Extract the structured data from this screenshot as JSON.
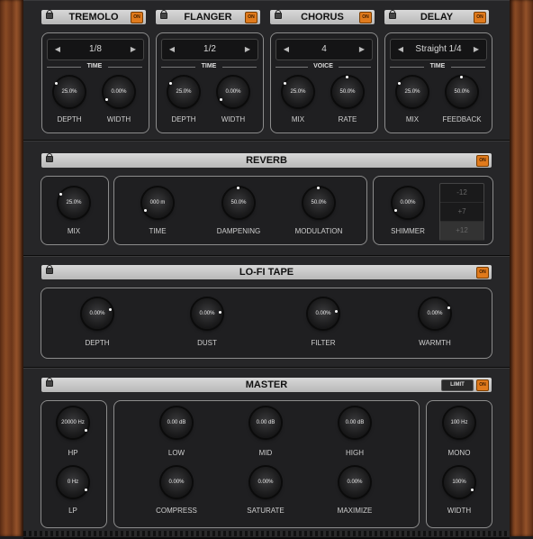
{
  "modules": {
    "tremolo": {
      "title": "TREMOLO",
      "on": "ON",
      "selector": "1/8",
      "section": "TIME",
      "knobs": [
        {
          "value": "25.0%",
          "label": "DEPTH"
        },
        {
          "value": "0.00%",
          "label": "WIDTH"
        }
      ]
    },
    "flanger": {
      "title": "FLANGER",
      "on": "ON",
      "selector": "1/2",
      "section": "TIME",
      "knobs": [
        {
          "value": "25.0%",
          "label": "DEPTH"
        },
        {
          "value": "0.00%",
          "label": "WIDTH"
        }
      ]
    },
    "chorus": {
      "title": "CHORUS",
      "on": "ON",
      "selector": "4",
      "section": "VOICE",
      "knobs": [
        {
          "value": "25.0%",
          "label": "MIX"
        },
        {
          "value": "50.0%",
          "label": "RATE"
        }
      ]
    },
    "delay": {
      "title": "DELAY",
      "on": "ON",
      "selector": "Straight 1/4",
      "section": "TIME",
      "knobs": [
        {
          "value": "25.0%",
          "label": "MIX"
        },
        {
          "value": "50.0%",
          "label": "FEEDBACK"
        }
      ]
    },
    "reverb": {
      "title": "REVERB",
      "on": "ON",
      "knobs": [
        {
          "value": "25.0%",
          "label": "MIX"
        },
        {
          "value": "000 m",
          "label": "TIME"
        },
        {
          "value": "50.0%",
          "label": "DAMPENING"
        },
        {
          "value": "50.0%",
          "label": "MODULATION"
        },
        {
          "value": "0.00%",
          "label": "SHIMMER"
        }
      ],
      "shimmer_options": [
        "-12",
        "+7",
        "+12"
      ]
    },
    "lofi": {
      "title": "LO-FI TAPE",
      "on": "ON",
      "knobs": [
        {
          "value": "0.00%",
          "label": "DEPTH"
        },
        {
          "value": "0.00%",
          "label": "DUST"
        },
        {
          "value": "0.00%",
          "label": "FILTER"
        },
        {
          "value": "0.00%",
          "label": "WARMTH"
        }
      ]
    },
    "master": {
      "title": "MASTER",
      "on": "ON",
      "limit": "LIMIT",
      "knobs": [
        {
          "value": "20000 Hz",
          "label": "HP"
        },
        {
          "value": "0 Hz",
          "label": "LP"
        },
        {
          "value": "0.00 dB",
          "label": "LOW"
        },
        {
          "value": "0.00 dB",
          "label": "MID"
        },
        {
          "value": "0.00 dB",
          "label": "HIGH"
        },
        {
          "value": "0.00%",
          "label": "COMPRESS"
        },
        {
          "value": "0.00%",
          "label": "SATURATE"
        },
        {
          "value": "0.00%",
          "label": "MAXIMIZE"
        },
        {
          "value": "100 Hz",
          "label": "MONO"
        },
        {
          "value": "100%",
          "label": "WIDTH"
        }
      ]
    }
  },
  "icons": {
    "lock": "lock-icon",
    "left": "chevron-left-icon",
    "right": "chevron-right-icon"
  },
  "colors": {
    "accent": "#e07a1c",
    "wood": "#7a3f1e",
    "panel": "#262628"
  }
}
